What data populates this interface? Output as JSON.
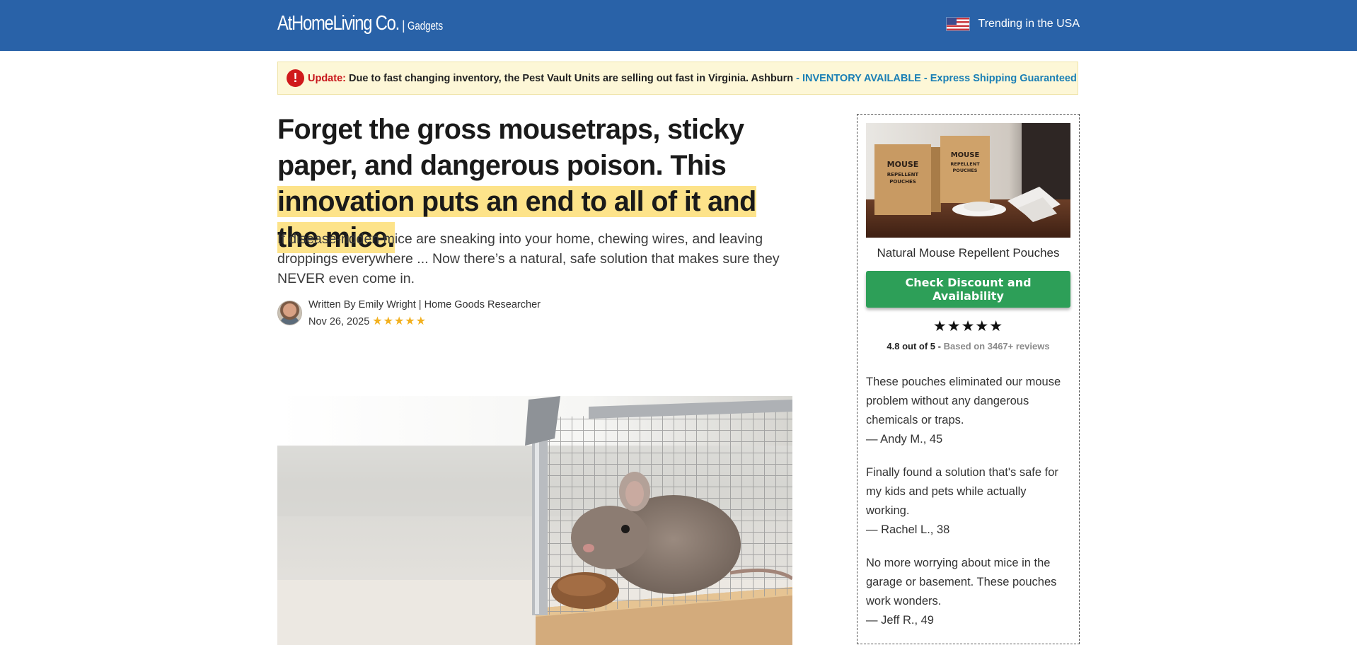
{
  "header": {
    "brand_name": "AtHomeLiving Co.",
    "brand_separator": "|",
    "brand_tag": "Gadgets",
    "trending_text": "Trending in the USA",
    "flag_icon": "us-flag-icon",
    "bg_color": "#2962a8"
  },
  "alert": {
    "icon": "exclamation-icon",
    "label": "Update:",
    "text": "Due to fast changing inventory, the Pest Vault Units are selling out fast in Virginia. Ashburn",
    "accent": "- INVENTORY AVAILABLE - Express Shipping Guaranteed"
  },
  "article": {
    "headline_plain": "Forget the gross mousetraps, sticky paper, and dangerous poison. This ",
    "headline_highlight": "innovation puts an end to all of it and the mice.",
    "subheadline": "If disease-ridden mice are sneaking into your home, chewing wires, and leaving droppings everywhere ... Now there’s a natural, safe solution that makes sure they NEVER even come in.",
    "byline": "Written By Emily Wright | Home Goods Researcher",
    "date": "Nov 26, 2025",
    "stars": "★★★★★"
  },
  "sidebar": {
    "product_name": "Natural Mouse Repellent Pouches",
    "box_label": "MOUSE REPELLENT POUCHES",
    "cta_label": "Check Discount and Availability",
    "cta_color": "#2d9f58",
    "stars": "★★★★★",
    "rating_text": "4.8 out of 5 -",
    "rating_count": "Based on 3467+ reviews",
    "reviews": [
      {
        "text": "These pouches eliminated our mouse problem without any dangerous chemicals or traps.",
        "author": "— Andy M., 45"
      },
      {
        "text": "Finally found a solution that's safe for my kids and pets while actually working.",
        "author": "— Rachel L., 38"
      },
      {
        "text": "No more worrying about mice in the garage or basement. These pouches work wonders.",
        "author": "— Jeff R., 49"
      }
    ]
  }
}
